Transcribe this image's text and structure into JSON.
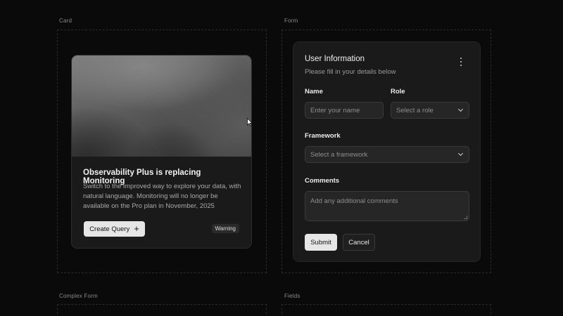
{
  "sections": {
    "card_label": "Card",
    "form_label": "Form",
    "complex_form_label": "Complex Form",
    "fields_label": "Fields"
  },
  "card": {
    "image_icon": "abstract-grayscale-image",
    "title": "Observability Plus is replacing Monitoring",
    "description": "Switch to the improved way to explore your data, with natural language. Monitoring will no longer be available on the Pro plan in November, 2025",
    "create_button_label": "Create Query",
    "create_button_icon": "plus-icon",
    "badge": "Warning"
  },
  "form": {
    "title": "User Information",
    "subtitle": "Please fill in your details below",
    "menu_icon": "kebab-menu-icon",
    "name_label": "Name",
    "name_placeholder": "Enter your name",
    "role_label": "Role",
    "role_value": "Select a role",
    "framework_label": "Framework",
    "framework_value": "Select a framework",
    "comments_label": "Comments",
    "comments_placeholder": "Add any additional comments",
    "submit_label": "Submit",
    "cancel_label": "Cancel"
  },
  "colors": {
    "background": "#0a0a0a",
    "card_bg": "#1a1a1a",
    "primary_button": "#e6e6e6",
    "input_bg": "#262626"
  }
}
